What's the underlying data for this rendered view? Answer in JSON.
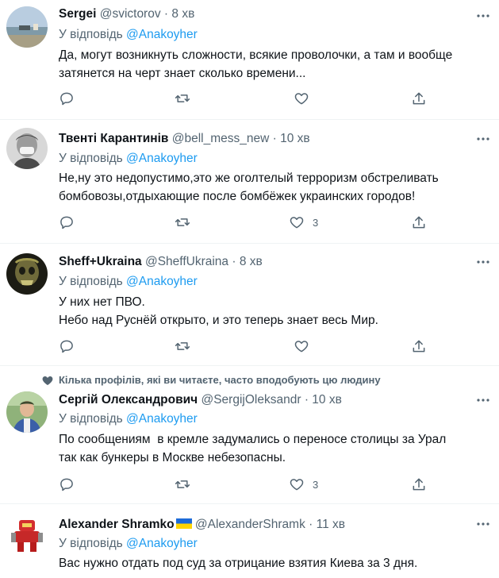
{
  "reply_prefix": "У відповідь",
  "tweets": [
    {
      "name": "Sergei",
      "handle": "@svictorov",
      "sep": "·",
      "time": "8 хв",
      "reply_to": "@Anakoyher",
      "lines": [
        "Да, могут возникнуть сложности, всякие проволочки, а там и вообще",
        "затянется на черт знает сколько времени..."
      ],
      "likes": ""
    },
    {
      "name": "Твенті Карантинів",
      "handle": "@bell_mess_new",
      "sep": "·",
      "time": "10 хв",
      "reply_to": "@Anakoyher",
      "lines": [
        "Не,ну это недопустимо,это же оголтелый терроризм обстреливать",
        "бомбовозы,отдыхающие после бомбёжек украинских городов!"
      ],
      "likes": "3"
    },
    {
      "name": "Sheff+Ukraina",
      "handle": "@SheffUkraina",
      "sep": "·",
      "time": "8 хв",
      "reply_to": "@Anakoyher",
      "lines": [
        "У них нет ПВО.",
        "Небо над Руснёй открыто, и это теперь знает весь Мир."
      ],
      "likes": ""
    },
    {
      "social_context": "Кілька профілів, які ви читаєте, часто вподобують цю людину",
      "name": "Сергій Олександрович",
      "handle": "@SergijOleksandr",
      "sep": "·",
      "time": "10 хв",
      "reply_to": "@Anakoyher",
      "lines": [
        "По сообщениям  в кремле задумались о переносе столицы за Урал",
        "так как бункеры в Москве небезопасны."
      ],
      "likes": "3"
    },
    {
      "name": "Alexander Shramko",
      "handle": "@AlexanderShramk",
      "sep": "·",
      "time": "11 хв",
      "reply_to": "@Anakoyher",
      "lines": [
        "Вас нужно отдать под суд за отрицание взятия Киева за 3 дня."
      ],
      "likes": ""
    }
  ],
  "colors": {
    "text": "#0f1419",
    "secondary": "#536471",
    "accent": "#1d9bf0",
    "divider": "#eff3f4"
  },
  "icons": [
    "reply-icon",
    "retweet-icon",
    "like-icon",
    "share-icon",
    "more-icon",
    "heart-filled-icon"
  ]
}
